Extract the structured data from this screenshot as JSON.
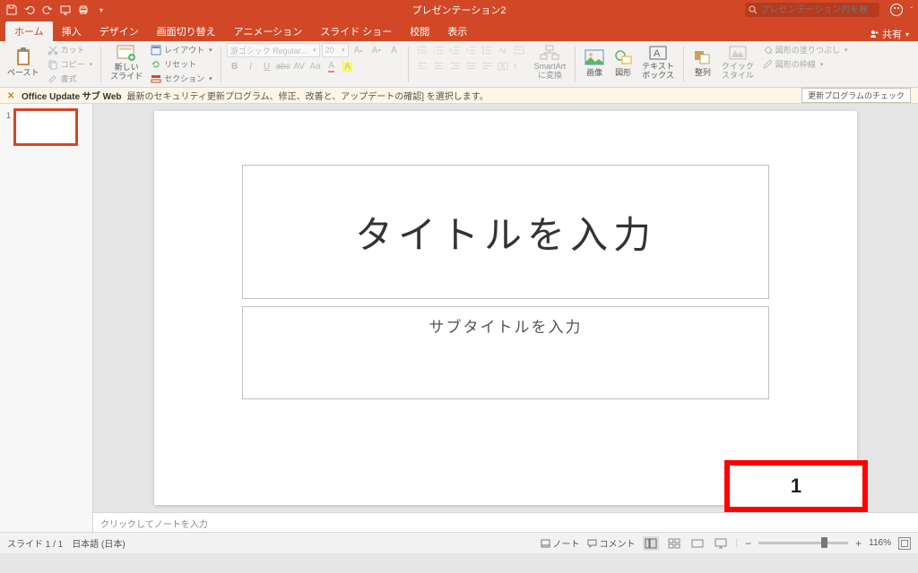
{
  "document_title": "プレゼンテーション2",
  "search": {
    "placeholder": "プレゼンテーション内を検索"
  },
  "tabs": {
    "home": "ホーム",
    "insert": "挿入",
    "design": "デザイン",
    "transitions": "画面切り替え",
    "animations": "アニメーション",
    "slideshow": "スライド ショー",
    "review": "校閲",
    "view": "表示"
  },
  "share_label": "共有",
  "ribbon": {
    "paste": "ペースト",
    "cut": "カット",
    "copy": "コピー",
    "format_painter": "書式",
    "new_slide": "新しい\nスライド",
    "layout": "レイアウト",
    "reset": "リセット",
    "section": "セクション",
    "font_name": "游ゴシック Regular...",
    "font_size": "20",
    "smartart": "SmartArt\nに変換",
    "picture": "画像",
    "shapes": "図形",
    "textbox": "テキスト\nボックス",
    "arrange": "整列",
    "quick_styles": "クイック\nスタイル",
    "shape_fill": "図形の塗りつぶし",
    "shape_outline": "図形の枠線"
  },
  "msgbar": {
    "title": "Office Update サブ Web",
    "text": "最新のセキュリティ更新プログラム、修正、改善と、アップデートの確認] を選択します。",
    "button": "更新プログラムのチェック"
  },
  "slide": {
    "title_placeholder": "タイトルを入力",
    "subtitle_placeholder": "サブタイトルを入力",
    "page_number": "1"
  },
  "thumbnail": {
    "number": "1"
  },
  "notes_placeholder": "クリックしてノートを入力",
  "status": {
    "slide_indicator": "スライド 1 / 1",
    "language": "日本語 (日本)",
    "notes_btn": "ノート",
    "comments_btn": "コメント",
    "zoom": "116%"
  }
}
